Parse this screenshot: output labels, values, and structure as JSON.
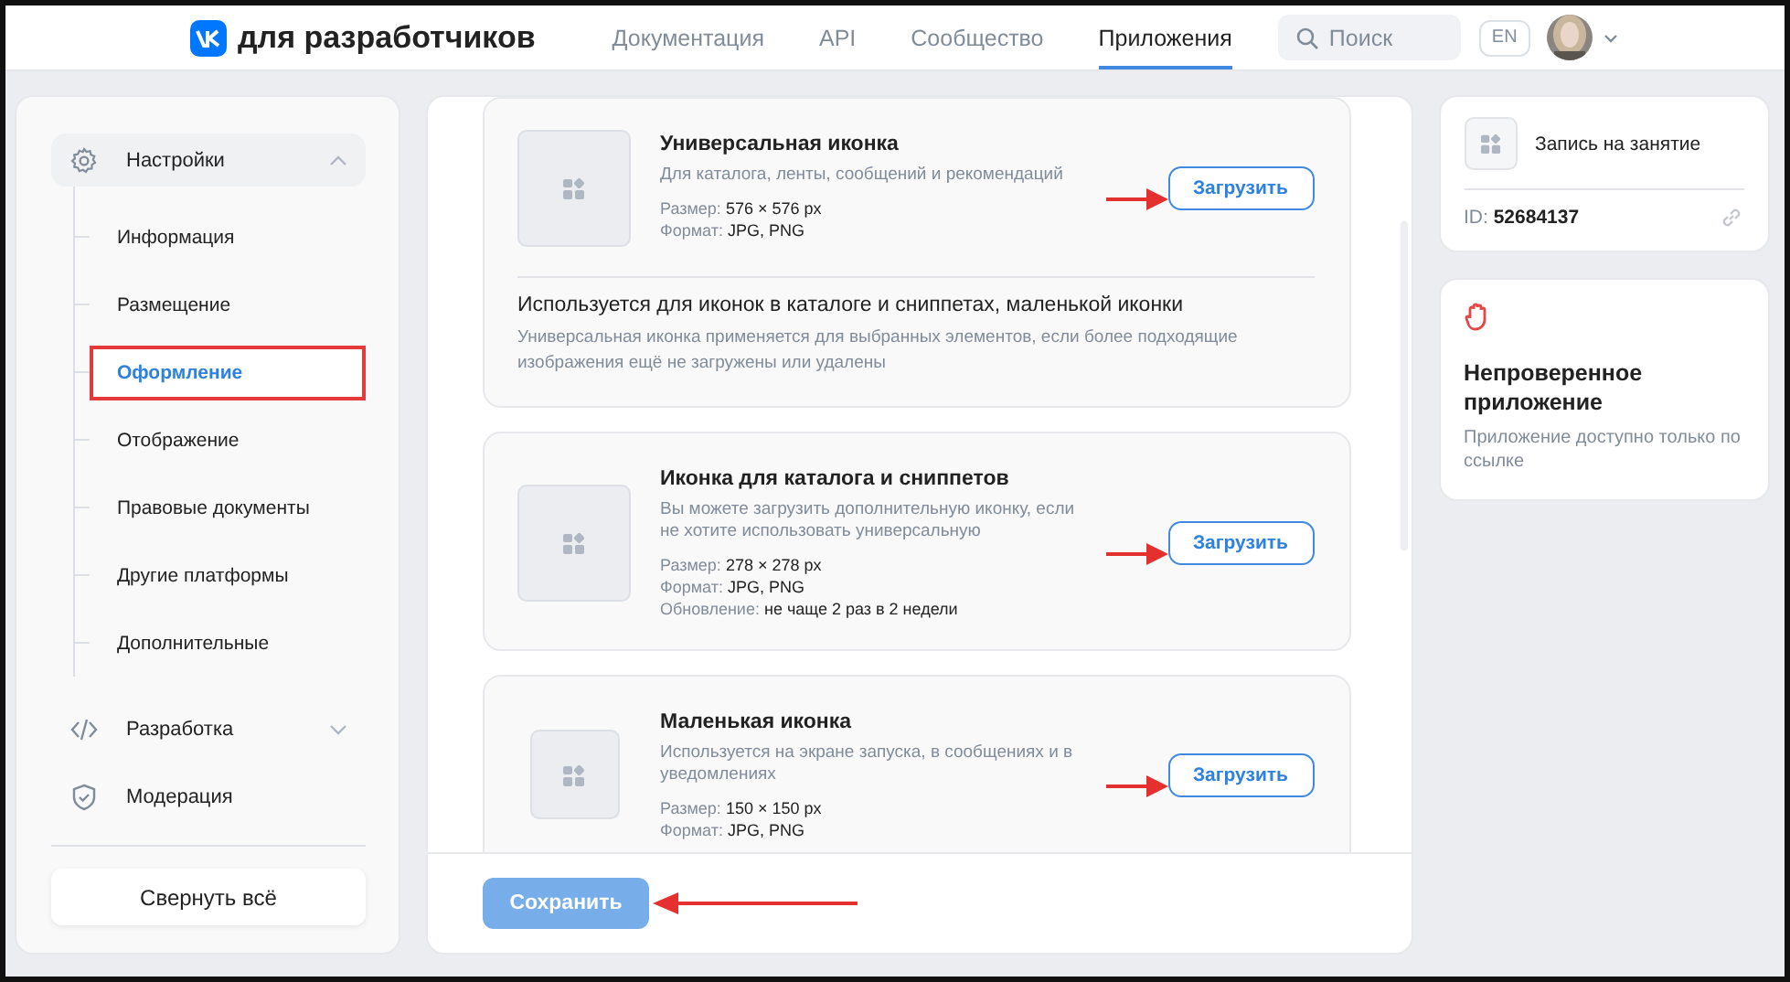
{
  "header": {
    "logo_text": "для разработчиков",
    "nav": [
      {
        "label": "Документация",
        "selected": false
      },
      {
        "label": "API",
        "selected": false
      },
      {
        "label": "Сообщество",
        "selected": false
      },
      {
        "label": "Приложения",
        "selected": true
      }
    ],
    "search": {
      "placeholder": "Поиск"
    },
    "language": "EN"
  },
  "sidebar": {
    "groups": [
      {
        "label": "Настройки",
        "expanded": true,
        "children": [
          {
            "label": "Информация",
            "selected": false,
            "highlighted": false
          },
          {
            "label": "Размещение",
            "selected": false,
            "highlighted": false
          },
          {
            "label": "Оформление",
            "selected": true,
            "highlighted": true
          },
          {
            "label": "Отображение",
            "selected": false,
            "highlighted": false
          },
          {
            "label": "Правовые документы",
            "selected": false,
            "highlighted": false
          },
          {
            "label": "Другие платформы",
            "selected": false,
            "highlighted": false
          },
          {
            "label": "Дополнительные",
            "selected": false,
            "highlighted": false
          }
        ]
      },
      {
        "label": "Разработка",
        "expanded": false
      },
      {
        "label": "Модерация"
      }
    ],
    "collapse_button": "Свернуть всё"
  },
  "cards": [
    {
      "title": "Универсальная иконка",
      "description": "Для каталога, ленты, сообщений и рекомендаций",
      "meta": [
        {
          "label": "Размер:",
          "value": "576 × 576 px"
        },
        {
          "label": "Формат:",
          "value": "JPG, PNG"
        }
      ],
      "button": "Загрузить",
      "annotated": true,
      "note": {
        "heading": "Используется для иконок в каталоге и сниппетах, маленькой иконки",
        "text": "Универсальная иконка применяется для выбранных элементов, если более подходящие изображения ещё не загружены или удалены"
      }
    },
    {
      "title": "Иконка для каталога и сниппетов",
      "description": "Вы можете загрузить дополнительную иконку, если не хотите использовать универсальную",
      "meta": [
        {
          "label": "Размер:",
          "value": "278 × 278 px"
        },
        {
          "label": "Формат:",
          "value": "JPG, PNG"
        },
        {
          "label": "Обновление:",
          "value": "не чаще 2 раз в 2 недели"
        }
      ],
      "button": "Загрузить",
      "annotated": true
    },
    {
      "title": "Маленькая иконка",
      "description": "Используется на экране запуска, в сообщениях и в уведомлениях",
      "meta": [
        {
          "label": "Размер:",
          "value": "150 × 150 px"
        },
        {
          "label": "Формат:",
          "value": "JPG, PNG"
        }
      ],
      "button": "Загрузить",
      "annotated": true
    }
  ],
  "save_button": {
    "label": "Сохранить",
    "disabled": true,
    "annotated": true
  },
  "app": {
    "name": "Запись на занятие",
    "id_label": "ID:",
    "id_value": "52684137"
  },
  "status": {
    "title": "Непроверенное приложение",
    "text": "Приложение доступно только по ссылке"
  }
}
